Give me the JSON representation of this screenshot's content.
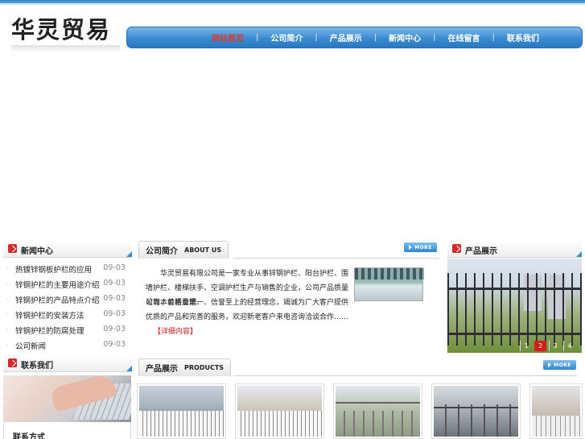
{
  "header": {
    "logo_text": "华灵贸易"
  },
  "nav": {
    "items": [
      {
        "label": "网站首页",
        "active": true
      },
      {
        "label": "公司简介",
        "active": false
      },
      {
        "label": "产品展示",
        "active": false
      },
      {
        "label": "新闻中心",
        "active": false
      },
      {
        "label": "在线留言",
        "active": false
      },
      {
        "label": "联系我们",
        "active": false
      }
    ],
    "separator": "|"
  },
  "news": {
    "title": "新闻中心",
    "items": [
      {
        "title": "热镀锌钢板护栏的应用",
        "date": "09-03"
      },
      {
        "title": "锌钢护栏的主要用途介绍",
        "date": "09-03"
      },
      {
        "title": "锌钢护栏的产品特点介绍",
        "date": "09-03"
      },
      {
        "title": "锌钢护栏的安装方法",
        "date": "09-03"
      },
      {
        "title": "锌钢护栏的防腐处理",
        "date": "09-03"
      },
      {
        "title": "公司新闻",
        "date": "09-03"
      }
    ]
  },
  "contact": {
    "title": "联系我们",
    "label": "联系方式"
  },
  "about": {
    "title_cn": "公司简介",
    "title_en": "ABOUT US",
    "more_label": "MORE",
    "paragraph1": "　　华灵贸易有限公司是一家专业从事锌钢护栏、阳台护栏、围墙护栏、楼梯扶手、空调护栏生产与销售的企业，公司产品质量可靠，价格合理。",
    "paragraph2": "公司本着质量第一、信誉至上的经营理念，竭诚为广大客户提供优质的产品和完善的服务，欢迎新老客户来电咨询洽谈合作……",
    "read_more": "【详细内容】"
  },
  "showcase": {
    "title": "产品展示",
    "pager": [
      "1",
      "2",
      "3",
      "4"
    ],
    "active_page": "2"
  },
  "products": {
    "title_cn": "产品展示",
    "title_en": "PRODUCTS",
    "more_label": "MORE"
  }
}
